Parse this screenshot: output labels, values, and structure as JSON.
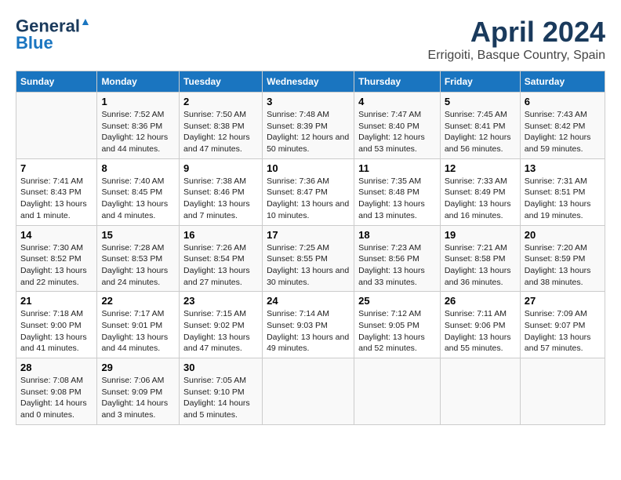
{
  "logo": {
    "line1": "General",
    "line2": "Blue"
  },
  "title": "April 2024",
  "subtitle": "Errigoiti, Basque Country, Spain",
  "headers": [
    "Sunday",
    "Monday",
    "Tuesday",
    "Wednesday",
    "Thursday",
    "Friday",
    "Saturday"
  ],
  "weeks": [
    [
      {
        "day": "",
        "sunrise": "",
        "sunset": "",
        "daylight": ""
      },
      {
        "day": "1",
        "sunrise": "Sunrise: 7:52 AM",
        "sunset": "Sunset: 8:36 PM",
        "daylight": "Daylight: 12 hours and 44 minutes."
      },
      {
        "day": "2",
        "sunrise": "Sunrise: 7:50 AM",
        "sunset": "Sunset: 8:38 PM",
        "daylight": "Daylight: 12 hours and 47 minutes."
      },
      {
        "day": "3",
        "sunrise": "Sunrise: 7:48 AM",
        "sunset": "Sunset: 8:39 PM",
        "daylight": "Daylight: 12 hours and 50 minutes."
      },
      {
        "day": "4",
        "sunrise": "Sunrise: 7:47 AM",
        "sunset": "Sunset: 8:40 PM",
        "daylight": "Daylight: 12 hours and 53 minutes."
      },
      {
        "day": "5",
        "sunrise": "Sunrise: 7:45 AM",
        "sunset": "Sunset: 8:41 PM",
        "daylight": "Daylight: 12 hours and 56 minutes."
      },
      {
        "day": "6",
        "sunrise": "Sunrise: 7:43 AM",
        "sunset": "Sunset: 8:42 PM",
        "daylight": "Daylight: 12 hours and 59 minutes."
      }
    ],
    [
      {
        "day": "7",
        "sunrise": "Sunrise: 7:41 AM",
        "sunset": "Sunset: 8:43 PM",
        "daylight": "Daylight: 13 hours and 1 minute."
      },
      {
        "day": "8",
        "sunrise": "Sunrise: 7:40 AM",
        "sunset": "Sunset: 8:45 PM",
        "daylight": "Daylight: 13 hours and 4 minutes."
      },
      {
        "day": "9",
        "sunrise": "Sunrise: 7:38 AM",
        "sunset": "Sunset: 8:46 PM",
        "daylight": "Daylight: 13 hours and 7 minutes."
      },
      {
        "day": "10",
        "sunrise": "Sunrise: 7:36 AM",
        "sunset": "Sunset: 8:47 PM",
        "daylight": "Daylight: 13 hours and 10 minutes."
      },
      {
        "day": "11",
        "sunrise": "Sunrise: 7:35 AM",
        "sunset": "Sunset: 8:48 PM",
        "daylight": "Daylight: 13 hours and 13 minutes."
      },
      {
        "day": "12",
        "sunrise": "Sunrise: 7:33 AM",
        "sunset": "Sunset: 8:49 PM",
        "daylight": "Daylight: 13 hours and 16 minutes."
      },
      {
        "day": "13",
        "sunrise": "Sunrise: 7:31 AM",
        "sunset": "Sunset: 8:51 PM",
        "daylight": "Daylight: 13 hours and 19 minutes."
      }
    ],
    [
      {
        "day": "14",
        "sunrise": "Sunrise: 7:30 AM",
        "sunset": "Sunset: 8:52 PM",
        "daylight": "Daylight: 13 hours and 22 minutes."
      },
      {
        "day": "15",
        "sunrise": "Sunrise: 7:28 AM",
        "sunset": "Sunset: 8:53 PM",
        "daylight": "Daylight: 13 hours and 24 minutes."
      },
      {
        "day": "16",
        "sunrise": "Sunrise: 7:26 AM",
        "sunset": "Sunset: 8:54 PM",
        "daylight": "Daylight: 13 hours and 27 minutes."
      },
      {
        "day": "17",
        "sunrise": "Sunrise: 7:25 AM",
        "sunset": "Sunset: 8:55 PM",
        "daylight": "Daylight: 13 hours and 30 minutes."
      },
      {
        "day": "18",
        "sunrise": "Sunrise: 7:23 AM",
        "sunset": "Sunset: 8:56 PM",
        "daylight": "Daylight: 13 hours and 33 minutes."
      },
      {
        "day": "19",
        "sunrise": "Sunrise: 7:21 AM",
        "sunset": "Sunset: 8:58 PM",
        "daylight": "Daylight: 13 hours and 36 minutes."
      },
      {
        "day": "20",
        "sunrise": "Sunrise: 7:20 AM",
        "sunset": "Sunset: 8:59 PM",
        "daylight": "Daylight: 13 hours and 38 minutes."
      }
    ],
    [
      {
        "day": "21",
        "sunrise": "Sunrise: 7:18 AM",
        "sunset": "Sunset: 9:00 PM",
        "daylight": "Daylight: 13 hours and 41 minutes."
      },
      {
        "day": "22",
        "sunrise": "Sunrise: 7:17 AM",
        "sunset": "Sunset: 9:01 PM",
        "daylight": "Daylight: 13 hours and 44 minutes."
      },
      {
        "day": "23",
        "sunrise": "Sunrise: 7:15 AM",
        "sunset": "Sunset: 9:02 PM",
        "daylight": "Daylight: 13 hours and 47 minutes."
      },
      {
        "day": "24",
        "sunrise": "Sunrise: 7:14 AM",
        "sunset": "Sunset: 9:03 PM",
        "daylight": "Daylight: 13 hours and 49 minutes."
      },
      {
        "day": "25",
        "sunrise": "Sunrise: 7:12 AM",
        "sunset": "Sunset: 9:05 PM",
        "daylight": "Daylight: 13 hours and 52 minutes."
      },
      {
        "day": "26",
        "sunrise": "Sunrise: 7:11 AM",
        "sunset": "Sunset: 9:06 PM",
        "daylight": "Daylight: 13 hours and 55 minutes."
      },
      {
        "day": "27",
        "sunrise": "Sunrise: 7:09 AM",
        "sunset": "Sunset: 9:07 PM",
        "daylight": "Daylight: 13 hours and 57 minutes."
      }
    ],
    [
      {
        "day": "28",
        "sunrise": "Sunrise: 7:08 AM",
        "sunset": "Sunset: 9:08 PM",
        "daylight": "Daylight: 14 hours and 0 minutes."
      },
      {
        "day": "29",
        "sunrise": "Sunrise: 7:06 AM",
        "sunset": "Sunset: 9:09 PM",
        "daylight": "Daylight: 14 hours and 3 minutes."
      },
      {
        "day": "30",
        "sunrise": "Sunrise: 7:05 AM",
        "sunset": "Sunset: 9:10 PM",
        "daylight": "Daylight: 14 hours and 5 minutes."
      },
      {
        "day": "",
        "sunrise": "",
        "sunset": "",
        "daylight": ""
      },
      {
        "day": "",
        "sunrise": "",
        "sunset": "",
        "daylight": ""
      },
      {
        "day": "",
        "sunrise": "",
        "sunset": "",
        "daylight": ""
      },
      {
        "day": "",
        "sunrise": "",
        "sunset": "",
        "daylight": ""
      }
    ]
  ]
}
